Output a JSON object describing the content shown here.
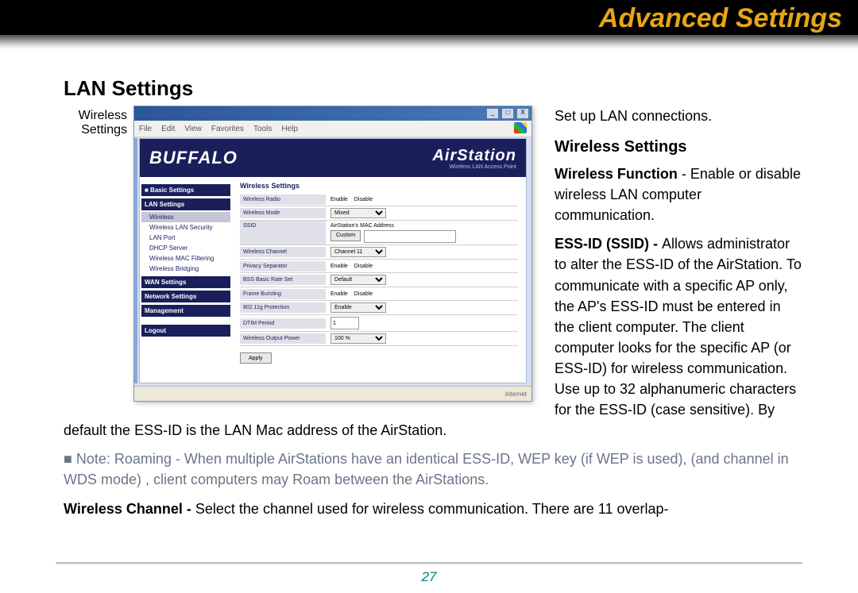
{
  "header": {
    "title": "Advanced Settings"
  },
  "page_number": "27",
  "section_title": "LAN Settings",
  "screenshot": {
    "caption": "Wireless Settings",
    "window_controls": {
      "min": "_",
      "max": "□",
      "close": "X"
    },
    "menubar": [
      "File",
      "Edit",
      "View",
      "Favorites",
      "Tools",
      "Help"
    ],
    "brand_left": "BUFFALO",
    "brand_right": "AirStation",
    "brand_sub": "Wireless LAN Access Point",
    "sidebar": {
      "group1": "■ Basic Settings",
      "group2_label": "LAN Settings",
      "items": [
        "Wireless",
        "Wireless LAN Security",
        "LAN Port",
        "DHCP Server",
        "Wireless MAC Filtering",
        "Wireless Bridging"
      ],
      "group3": "WAN Settings",
      "group4": "Network Settings",
      "group5": "Management",
      "group6": "Logout"
    },
    "panel": {
      "title": "Wireless Settings",
      "rows": [
        {
          "label": "Wireless Radio",
          "enable": "Enable",
          "disable": "Disable"
        },
        {
          "label": "Wireless Mode",
          "select": "Mixed"
        },
        {
          "label": "SSID",
          "hint": "AirStation's MAC Address",
          "btn": "Custom"
        },
        {
          "label": "Wireless Channel",
          "select": "Channel 11"
        },
        {
          "label": "Privacy Separator",
          "enable": "Enable",
          "disable": "Disable"
        },
        {
          "label": "BSS Basic Rate Set",
          "select": "Default"
        },
        {
          "label": "Frame Bursting",
          "enable": "Enable",
          "disable": "Disable"
        },
        {
          "label": "802.11g Protection",
          "select": "Enable"
        },
        {
          "label": "DTIM Period",
          "input": "1"
        },
        {
          "label": "Wireless Output Power",
          "select": "100 %"
        }
      ],
      "apply": "Apply"
    },
    "status": "Internet"
  },
  "body": {
    "intro": "Set up LAN connections.",
    "sub_heading": "Wireless Settings",
    "para_wireless_function": "Wireless Function - Enable or disable wireless LAN computer communication.",
    "para_essid_lead": "ESS-ID (SSID) - ",
    "para_essid_rest": "Allows administrator to alter the ESS-ID of the AirStation.  To communicate with a specific  AP only,  the AP's ESS-ID must be entered in the client computer.  The client computer looks for the specific AP (or ESS-ID) for wireless communication.  Use up to 32 alphanumeric characters for the ESS-ID (case sensitive).  By default the ESS-ID is the LAN Mac address of the AirStation.",
    "note": "■ Note:  Roaming - When multiple AirStations have an identical ESS-ID, WEP key (if WEP is used), (and channel in WDS mode) , client computers may Roam between the AirStations.",
    "para_channel_lead": "Wireless Channel  - ",
    "para_channel_rest": "Select the channel used for wireless communication.  There are 11 overlap-"
  }
}
